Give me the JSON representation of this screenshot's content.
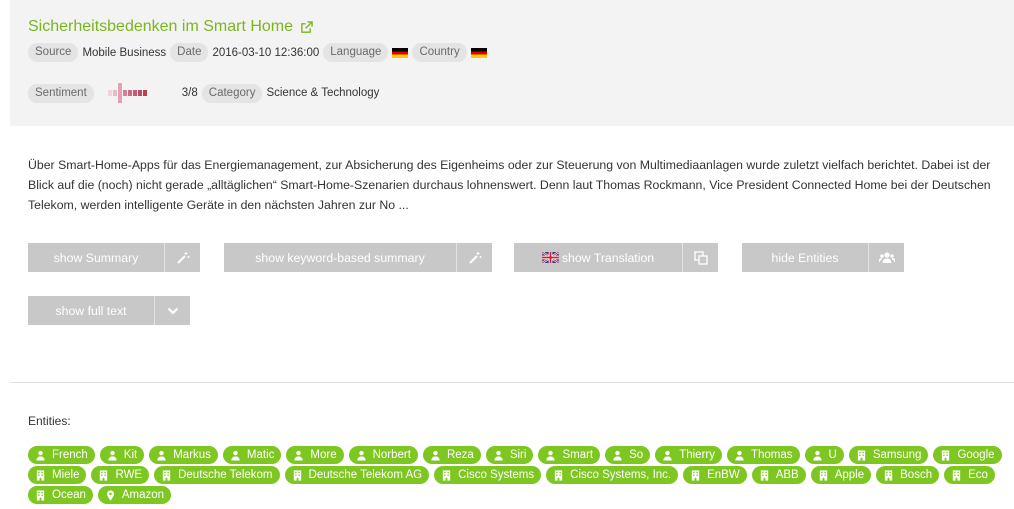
{
  "article": {
    "title": "Sicherheitsbedenken im Smart Home",
    "source_label": "Source",
    "source": "Mobile Business",
    "date_label": "Date",
    "date": "2016-03-10 12:36:00",
    "language_label": "Language",
    "country_label": "Country",
    "sentiment_label": "Sentiment",
    "sentiment_score": "3/8",
    "sentiment_value": 0.375,
    "category_label": "Category",
    "category": "Science & Technology",
    "flag": "german-flag-icon",
    "text": "Über Smart-Home-Apps für das Energiemanagement, zur Absicherung des Eigenheims oder zur Steuerung von Multimediaanlagen wurde zuletzt vielfach berichtet. Dabei ist der Blick auf die (noch) nicht gerade „alltäglichen“ Smart-Home-Szenarien durchaus lohnenswert. Denn laut Thomas Rockmann, Vice President Connected Home bei der Deutschen Telekom, werden intelligente Geräte in den nächsten Jahren zur No ..."
  },
  "buttons": {
    "summary": "show Summary",
    "keyword_summary": "show keyword-based summary",
    "translation": "show Translation",
    "entities": "hide Entities",
    "full_text": "show full text"
  },
  "entities_label": "Entities:",
  "entities": [
    {
      "label": "French",
      "type": "person-icon"
    },
    {
      "label": "Kit",
      "type": "person-icon"
    },
    {
      "label": "Markus",
      "type": "person-icon"
    },
    {
      "label": "Matic",
      "type": "person-icon"
    },
    {
      "label": "More",
      "type": "person-icon"
    },
    {
      "label": "Norbert",
      "type": "person-icon"
    },
    {
      "label": "Reza",
      "type": "person-icon"
    },
    {
      "label": "Siri",
      "type": "person-icon"
    },
    {
      "label": "Smart",
      "type": "person-icon"
    },
    {
      "label": "So",
      "type": "person-icon"
    },
    {
      "label": "Thierry",
      "type": "person-icon"
    },
    {
      "label": "Thomas",
      "type": "person-icon"
    },
    {
      "label": "U",
      "type": "person-icon"
    },
    {
      "label": "Samsung",
      "type": "building-icon"
    },
    {
      "label": "Google",
      "type": "building-icon"
    },
    {
      "label": "Miele",
      "type": "building-icon"
    },
    {
      "label": "RWE",
      "type": "building-icon"
    },
    {
      "label": "Deutsche Telekom",
      "type": "building-icon"
    },
    {
      "label": "Deutsche Telekom AG",
      "type": "building-icon"
    },
    {
      "label": "Cisco Systems",
      "type": "building-icon"
    },
    {
      "label": "Cisco Systems, Inc.",
      "type": "building-icon"
    },
    {
      "label": "EnBW",
      "type": "building-icon"
    },
    {
      "label": "ABB",
      "type": "building-icon"
    },
    {
      "label": "Apple",
      "type": "building-icon"
    },
    {
      "label": "Bosch",
      "type": "building-icon"
    },
    {
      "label": "Eco",
      "type": "building-icon"
    },
    {
      "label": "Ocean",
      "type": "building-icon"
    },
    {
      "label": "Amazon",
      "type": "location-pin-icon"
    }
  ],
  "colors": {
    "accent": "#7ab61e",
    "tag_bg": "#7ec722",
    "button_bg": "#c8c8c8",
    "header_bg": "#f3f3f3",
    "sentiment_negative": "#c04a63"
  }
}
